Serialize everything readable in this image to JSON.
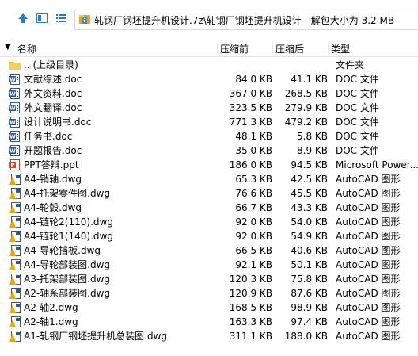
{
  "toolbar": {
    "path": "轧钢厂钢坯提升机设计.7z\\轧钢厂钢坯提升机设计 - 解包大小为 3.2 MB"
  },
  "columns": {
    "name": "名称",
    "original": "压缩前",
    "compressed": "压缩后",
    "type": "类型"
  },
  "rows": [
    {
      "icon": "folder-up-icon",
      "name": ".. (上级目录)",
      "original": "",
      "compressed": "",
      "type": "文件夹"
    },
    {
      "icon": "doc-icon",
      "name": "文献综述.doc",
      "original": "84.0 KB",
      "compressed": "41.1 KB",
      "type": "DOC 文件"
    },
    {
      "icon": "doc-icon",
      "name": "外文资料.doc",
      "original": "367.0 KB",
      "compressed": "268.5 KB",
      "type": "DOC 文件"
    },
    {
      "icon": "doc-icon",
      "name": "外文翻译.doc",
      "original": "323.5 KB",
      "compressed": "279.9 KB",
      "type": "DOC 文件"
    },
    {
      "icon": "doc-icon",
      "name": "设计说明书.doc",
      "original": "771.3 KB",
      "compressed": "479.2 KB",
      "type": "DOC 文件"
    },
    {
      "icon": "doc-icon",
      "name": "任务书.doc",
      "original": "48.1 KB",
      "compressed": "5.8 KB",
      "type": "DOC 文件"
    },
    {
      "icon": "doc-icon",
      "name": "开题报告.doc",
      "original": "35.0 KB",
      "compressed": "8.9 KB",
      "type": "DOC 文件"
    },
    {
      "icon": "ppt-icon",
      "name": "PPT答辩.ppt",
      "original": "186.0 KB",
      "compressed": "94.5 KB",
      "type": "Microsoft Power..."
    },
    {
      "icon": "dwg-icon",
      "name": "A4-销轴.dwg",
      "original": "65.3 KB",
      "compressed": "42.5 KB",
      "type": "AutoCAD 图形"
    },
    {
      "icon": "dwg-icon",
      "name": "A4-托架零件图.dwg",
      "original": "76.6 KB",
      "compressed": "45.5 KB",
      "type": "AutoCAD 图形"
    },
    {
      "icon": "dwg-icon",
      "name": "A4-轮毂.dwg",
      "original": "66.7 KB",
      "compressed": "43.3 KB",
      "type": "AutoCAD 图形"
    },
    {
      "icon": "dwg-icon",
      "name": "A4-链轮2(110).dwg",
      "original": "92.0 KB",
      "compressed": "54.0 KB",
      "type": "AutoCAD 图形"
    },
    {
      "icon": "dwg-icon",
      "name": "A4-链轮1(140).dwg",
      "original": "92.0 KB",
      "compressed": "54.9 KB",
      "type": "AutoCAD 图形"
    },
    {
      "icon": "dwg-icon",
      "name": "A4-导轮挡板.dwg",
      "original": "66.5 KB",
      "compressed": "40.6 KB",
      "type": "AutoCAD 图形"
    },
    {
      "icon": "dwg-icon",
      "name": "A4-导轮部装图.dwg",
      "original": "92.1 KB",
      "compressed": "50.1 KB",
      "type": "AutoCAD 图形"
    },
    {
      "icon": "dwg-icon",
      "name": "A3-托架部装图.dwg",
      "original": "120.3 KB",
      "compressed": "75.8 KB",
      "type": "AutoCAD 图形"
    },
    {
      "icon": "dwg-icon",
      "name": "A2-轴系部装图.dwg",
      "original": "120.9 KB",
      "compressed": "87.6 KB",
      "type": "AutoCAD 图形"
    },
    {
      "icon": "dwg-icon",
      "name": "A2-轴2.dwg",
      "original": "168.5 KB",
      "compressed": "98.9 KB",
      "type": "AutoCAD 图形"
    },
    {
      "icon": "dwg-icon",
      "name": "A2-轴1.dwg",
      "original": "163.3 KB",
      "compressed": "97.4 KB",
      "type": "AutoCAD 图形"
    },
    {
      "icon": "dwg-icon",
      "name": "A1-轧钢厂钢坯提升机总装图.dwg",
      "original": "311.1 KB",
      "compressed": "188.0 KB",
      "type": "AutoCAD 图形"
    }
  ]
}
